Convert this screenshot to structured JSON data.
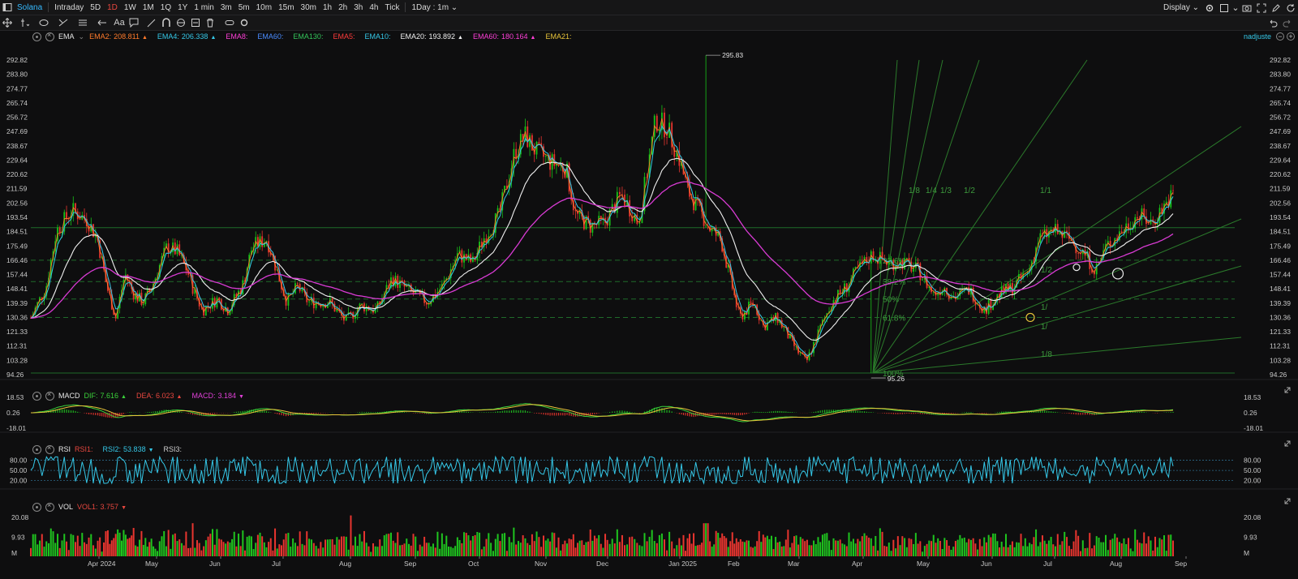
{
  "topbar": {
    "symbol": "Solana",
    "timeframes": [
      "Intraday",
      "5D",
      "1D",
      "1W",
      "1M",
      "1Q",
      "1Y",
      "1 min",
      "3m",
      "5m",
      "10m",
      "15m",
      "30m",
      "1h",
      "2h",
      "3h",
      "4h",
      "Tick"
    ],
    "active_timeframe": "1D",
    "interval_select": "1Day : 1m",
    "display_label": "Display"
  },
  "main_legend": {
    "name": "EMA",
    "items": [
      {
        "label": "EMA2:",
        "value": "208.811",
        "color": "#ff7a2b",
        "arrow": "▲"
      },
      {
        "label": "EMA4:",
        "value": "206.338",
        "color": "#35c8e8",
        "arrow": "▲"
      },
      {
        "label": "EMA8:",
        "value": "",
        "color": "#ff3fd8",
        "arrow": ""
      },
      {
        "label": "EMA60:",
        "value": "",
        "color": "#4a8cff",
        "arrow": ""
      },
      {
        "label": "EMA130:",
        "value": "",
        "color": "#33c45a",
        "arrow": ""
      },
      {
        "label": "EMA5:",
        "value": "",
        "color": "#ff3b3b",
        "arrow": ""
      },
      {
        "label": "EMA10:",
        "value": "",
        "color": "#35c8e8",
        "arrow": ""
      },
      {
        "label": "EMA20:",
        "value": "193.892",
        "color": "#f0f0f0",
        "arrow": "▲"
      },
      {
        "label": "EMA60:",
        "value": "180.164",
        "color": "#ff3fd8",
        "arrow": "▲"
      },
      {
        "label": "EMA21:",
        "value": "",
        "color": "#e8c43a",
        "arrow": ""
      }
    ],
    "adjust_label": "nadjuste"
  },
  "price_axis": {
    "ticks": [
      "292.82",
      "283.80",
      "274.77",
      "265.74",
      "256.72",
      "247.69",
      "238.67",
      "229.64",
      "220.62",
      "211.59",
      "202.56",
      "193.54",
      "184.51",
      "175.49",
      "166.46",
      "157.44",
      "148.41",
      "139.39",
      "130.36",
      "121.33",
      "112.31",
      "103.28",
      "94.26"
    ]
  },
  "annotations": {
    "high": "295.83",
    "low": "95.26",
    "fib_levels": [
      "23.6%",
      "38.2%",
      "50%",
      "61.8%",
      "100%"
    ],
    "fan_labels_upper": [
      "1/8",
      "1/4",
      "1/3",
      "1/2",
      "1/1"
    ],
    "fan_labels_lower": [
      "1/2",
      "1/",
      "1/",
      "1/8"
    ]
  },
  "macd_legend": {
    "name": "MACD",
    "items": [
      {
        "label": "DIF:",
        "value": "7.616",
        "color": "#3ad13a",
        "arrow": "▲"
      },
      {
        "label": "DEA:",
        "value": "6.023",
        "color": "#e8473f",
        "arrow": "▲"
      },
      {
        "label": "MACD:",
        "value": "3.184",
        "color": "#e040d8",
        "arrow": "▼"
      }
    ],
    "ticks": [
      "18.53",
      "0.26",
      "-18.01"
    ]
  },
  "rsi_legend": {
    "name": "RSI",
    "items": [
      {
        "label": "RSI1:",
        "value": "",
        "color": "#e8473f",
        "arrow": ""
      },
      {
        "label": "RSI2:",
        "value": "53.838",
        "color": "#35c8e8",
        "arrow": "▼"
      },
      {
        "label": "RSI3:",
        "value": "",
        "color": "#d0d0d0",
        "arrow": ""
      }
    ],
    "ticks": [
      "80.00",
      "50.00",
      "20.00"
    ]
  },
  "vol_legend": {
    "name": "VOL",
    "items": [
      {
        "label": "VOL1:",
        "value": "3.757",
        "color": "#e8473f",
        "arrow": "▼"
      }
    ],
    "ticks": [
      "20.08",
      "9.93",
      "M"
    ]
  },
  "time_axis": {
    "labels": [
      "Apr 2024",
      "May",
      "Jun",
      "Jul",
      "Aug",
      "Sep",
      "Oct",
      "Nov",
      "Dec",
      "Jan 2025",
      "Feb",
      "Mar",
      "Apr",
      "May",
      "Jun",
      "Jul",
      "Aug",
      "Sep"
    ]
  },
  "chart_data": {
    "type": "candlestick",
    "title": "Solana",
    "interval": "1D",
    "y_range": [
      94.26,
      292.82
    ],
    "months": [
      "Apr 2024",
      "May",
      "Jun",
      "Jul",
      "Aug",
      "Sep",
      "Oct",
      "Nov",
      "Dec",
      "Jan 2025",
      "Feb",
      "Mar",
      "Apr",
      "May",
      "Jun",
      "Jul",
      "Aug",
      "Sep"
    ],
    "approx_close_path": [
      [
        0,
        130
      ],
      [
        0.3,
        150
      ],
      [
        0.5,
        185
      ],
      [
        0.8,
        198
      ],
      [
        1.1,
        192
      ],
      [
        1.3,
        180
      ],
      [
        1.5,
        150
      ],
      [
        1.7,
        130
      ],
      [
        1.9,
        158
      ],
      [
        2.1,
        145
      ],
      [
        2.3,
        140
      ],
      [
        2.5,
        150
      ],
      [
        2.8,
        175
      ],
      [
        3.0,
        172
      ],
      [
        3.2,
        160
      ],
      [
        3.3,
        150
      ],
      [
        3.5,
        135
      ],
      [
        3.8,
        142
      ],
      [
        4.0,
        135
      ],
      [
        4.3,
        150
      ],
      [
        4.5,
        175
      ],
      [
        4.8,
        180
      ],
      [
        5.0,
        160
      ],
      [
        5.2,
        140
      ],
      [
        5.4,
        150
      ],
      [
        5.6,
        140
      ],
      [
        6.0,
        140
      ],
      [
        6.3,
        128
      ],
      [
        6.6,
        138
      ],
      [
        6.9,
        135
      ],
      [
        7.2,
        155
      ],
      [
        7.5,
        148
      ],
      [
        7.9,
        140
      ],
      [
        8.2,
        150
      ],
      [
        8.5,
        170
      ],
      [
        8.8,
        165
      ],
      [
        9.0,
        180
      ],
      [
        9.3,
        195
      ],
      [
        9.6,
        235
      ],
      [
        9.8,
        245
      ],
      [
        10.0,
        235
      ],
      [
        10.3,
        228
      ],
      [
        10.6,
        225
      ],
      [
        10.8,
        195
      ],
      [
        11.1,
        188
      ],
      [
        11.4,
        190
      ],
      [
        11.7,
        208
      ],
      [
        12.0,
        190
      ],
      [
        12.3,
        255
      ],
      [
        12.5,
        250
      ],
      [
        12.7,
        232
      ],
      [
        12.9,
        210
      ],
      [
        13.1,
        200
      ],
      [
        13.4,
        185
      ],
      [
        13.6,
        180
      ],
      [
        13.8,
        155
      ],
      [
        14.0,
        130
      ],
      [
        14.3,
        140
      ],
      [
        14.5,
        125
      ],
      [
        14.8,
        130
      ],
      [
        15.0,
        120
      ],
      [
        15.2,
        110
      ],
      [
        15.4,
        102
      ],
      [
        15.6,
        118
      ],
      [
        15.9,
        140
      ],
      [
        16.2,
        150
      ],
      [
        16.4,
        160
      ],
      [
        16.7,
        170
      ],
      [
        17.0,
        165
      ],
      [
        17.3,
        165
      ],
      [
        17.6,
        160
      ],
      [
        17.9,
        145
      ],
      [
        18.1,
        150
      ],
      [
        18.3,
        143
      ],
      [
        18.6,
        148
      ],
      [
        18.9,
        135
      ],
      [
        19.2,
        145
      ],
      [
        19.5,
        150
      ],
      [
        19.8,
        160
      ],
      [
        20.0,
        180
      ],
      [
        20.3,
        185
      ],
      [
        20.6,
        180
      ],
      [
        20.9,
        170
      ],
      [
        21.1,
        160
      ],
      [
        21.3,
        175
      ],
      [
        21.6,
        185
      ],
      [
        21.9,
        195
      ],
      [
        22.2,
        190
      ],
      [
        22.4,
        200
      ],
      [
        22.6,
        208
      ]
    ],
    "high": 295.83,
    "low": 95.26,
    "ema_last": {
      "EMA2": 208.811,
      "EMA4": 206.338,
      "EMA20": 193.892,
      "EMA60": 180.164
    },
    "macd": {
      "DIF": 7.616,
      "DEA": 6.023,
      "MACD": 3.184,
      "range": [
        -18.01,
        18.53
      ]
    },
    "rsi": {
      "RSI2": 53.838,
      "levels": [
        20,
        50,
        80
      ]
    },
    "vol": {
      "VOL1": 3.757,
      "range_max": 20.08
    }
  }
}
